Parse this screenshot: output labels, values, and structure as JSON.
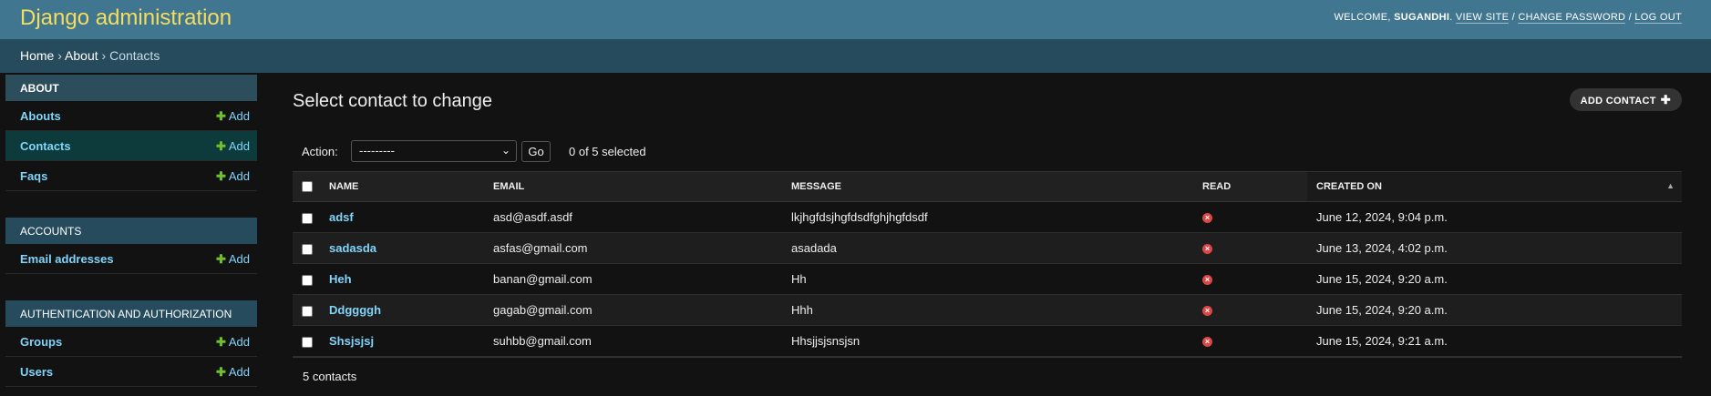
{
  "header": {
    "site_title": "Django administration",
    "welcome": "Welcome,",
    "username": "Sugandhi",
    "view_site": "View site",
    "change_password": "Change password",
    "log_out": "Log out"
  },
  "breadcrumbs": [
    "Home",
    "About",
    "Contacts"
  ],
  "sidebar": {
    "modules": [
      {
        "caption": "About",
        "models": [
          {
            "name": "Abouts",
            "add": "Add"
          },
          {
            "name": "Contacts",
            "add": "Add"
          },
          {
            "name": "Faqs",
            "add": "Add"
          }
        ]
      },
      {
        "caption": "Accounts",
        "models": [
          {
            "name": "Email addresses",
            "add": "Add"
          }
        ]
      },
      {
        "caption": "Authentication and Authorization",
        "models": [
          {
            "name": "Groups",
            "add": "Add"
          },
          {
            "name": "Users",
            "add": "Add"
          }
        ]
      }
    ]
  },
  "main": {
    "title": "Select contact to change",
    "add_button": "Add contact",
    "actions": {
      "label": "Action:",
      "selected_option": "---------",
      "go": "Go",
      "selected_count": "0 of 5 selected"
    },
    "table": {
      "columns": [
        "Name",
        "Email",
        "Message",
        "Read",
        "Created on"
      ],
      "rows": [
        {
          "name": "adsf",
          "email": "asd@asdf.asdf",
          "message": "lkjhgfdsjhgfdsdfghjhgfdsdf",
          "read": "false",
          "created_on": "June 12, 2024, 9:04 p.m."
        },
        {
          "name": "sadasda",
          "email": "asfas@gmail.com",
          "message": "asadada",
          "read": "false",
          "created_on": "June 13, 2024, 4:02 p.m."
        },
        {
          "name": "Heh",
          "email": "banan@gmail.com",
          "message": "Hh",
          "read": "false",
          "created_on": "June 15, 2024, 9:20 a.m."
        },
        {
          "name": "Ddggggh",
          "email": "gagab@gmail.com",
          "message": "Hhh",
          "read": "false",
          "created_on": "June 15, 2024, 9:20 a.m."
        },
        {
          "name": "Shsjsjsj",
          "email": "suhbb@gmail.com",
          "message": "Hhsjjsjsnsjsn",
          "read": "false",
          "created_on": "June 15, 2024, 9:21 a.m."
        }
      ]
    },
    "paginator": "5 contacts"
  },
  "colors": {
    "header_bg": "#417690",
    "breadcrumbs_bg": "#264b5d",
    "title_yellow": "#f5dd5d",
    "link_blue": "#81d4fa",
    "add_green": "#70bf2b",
    "false_red": "#dd4646"
  }
}
